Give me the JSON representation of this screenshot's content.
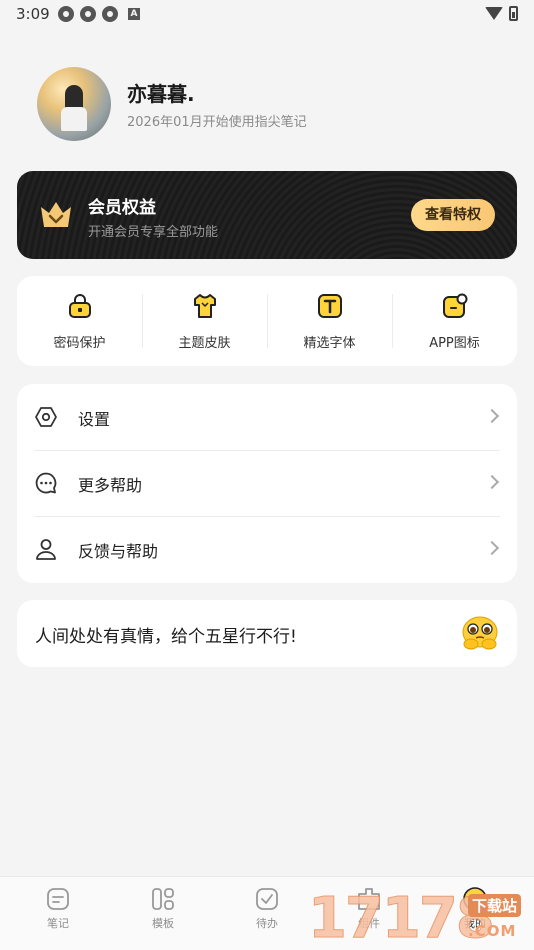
{
  "status_bar": {
    "time": "3:09",
    "badge": "A"
  },
  "profile": {
    "name": "亦暮暮.",
    "since": "2026年01月开始使用指尖笔记"
  },
  "vip": {
    "title": "会员权益",
    "subtitle": "开通会员专享全部功能",
    "button": "查看特权",
    "accent_color": "#f9c774"
  },
  "features": [
    {
      "label": "密码保护",
      "icon": "lock-icon"
    },
    {
      "label": "主题皮肤",
      "icon": "shirt-icon"
    },
    {
      "label": "精选字体",
      "icon": "font-icon"
    },
    {
      "label": "APP图标",
      "icon": "app-icon"
    }
  ],
  "menu": [
    {
      "label": "设置",
      "icon": "gear-icon"
    },
    {
      "label": "更多帮助",
      "icon": "chat-icon"
    },
    {
      "label": "反馈与帮助",
      "icon": "user-icon"
    }
  ],
  "rate": {
    "text": "人间处处有真情，给个五星行不行!",
    "icon": "pleading-emoji-icon"
  },
  "bottom_nav": [
    {
      "label": "笔记",
      "icon": "note-icon"
    },
    {
      "label": "模板",
      "icon": "template-icon"
    },
    {
      "label": "待办",
      "icon": "todo-icon"
    },
    {
      "label": "组件",
      "icon": "widget-icon"
    },
    {
      "label": "我的",
      "icon": "me-icon",
      "active": true
    }
  ],
  "watermark": {
    "digits": "17178",
    "tag": "下载站",
    "suffix": ".COM"
  }
}
